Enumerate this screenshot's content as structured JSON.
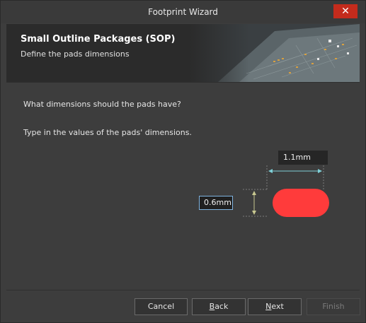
{
  "window": {
    "title": "Footprint Wizard",
    "close_glyph": "✕"
  },
  "banner": {
    "title": "Small Outline Packages (SOP)",
    "subtitle": "Define the pads dimensions"
  },
  "content": {
    "question": "What dimensions should the pads have?",
    "instruction": "Type in the values of the pads' dimensions.",
    "pad_width": "1.1mm",
    "pad_height": "0.6mm"
  },
  "buttons": {
    "cancel": "Cancel",
    "back_u": "B",
    "back_rest": "ack",
    "next_u": "N",
    "next_rest": "ext",
    "finish": "Finish"
  },
  "colors": {
    "pad": "#ff3b3b",
    "width_arrow": "#7fd0d8",
    "height_arrow": "#c8c890",
    "close": "#c42b1c"
  }
}
